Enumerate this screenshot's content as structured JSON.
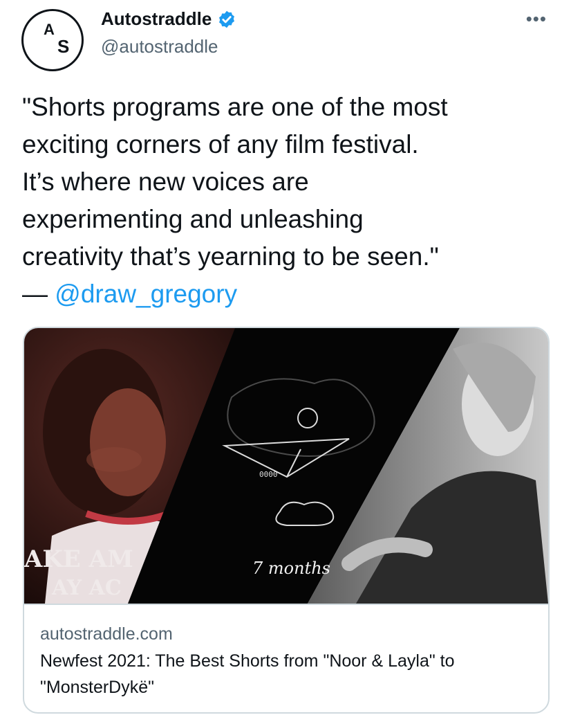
{
  "author": {
    "avatar_letters": [
      "A",
      "S"
    ],
    "display_name": "Autostraddle",
    "handle": "@autostraddle"
  },
  "icons": {
    "verified": "verified-badge-icon",
    "more": "more-options-icon",
    "verified_color": "#1d9bf0"
  },
  "more_label": "•••",
  "tweet": {
    "text": "\"Shorts programs are one of the most\nexciting corners of any film festival.\nIt’s where new voices are\nexperimenting and unleashing\ncreativity that’s yearning to be seen.\"\n— ",
    "mention": "@draw_gregory"
  },
  "card": {
    "image_text": {
      "shirt_line1": "AKE AM",
      "shirt_line2": "AY AC",
      "caption": "7 months",
      "plane_text": "0000"
    },
    "domain": "autostraddle.com",
    "title": "Newfest 2021: The Best Shorts from \"Noor & Layla\" to \"MonsterDykë\""
  },
  "colors": {
    "text": "#0f1419",
    "secondary": "#536471",
    "link": "#1d9bf0",
    "border": "#cfd9de"
  }
}
